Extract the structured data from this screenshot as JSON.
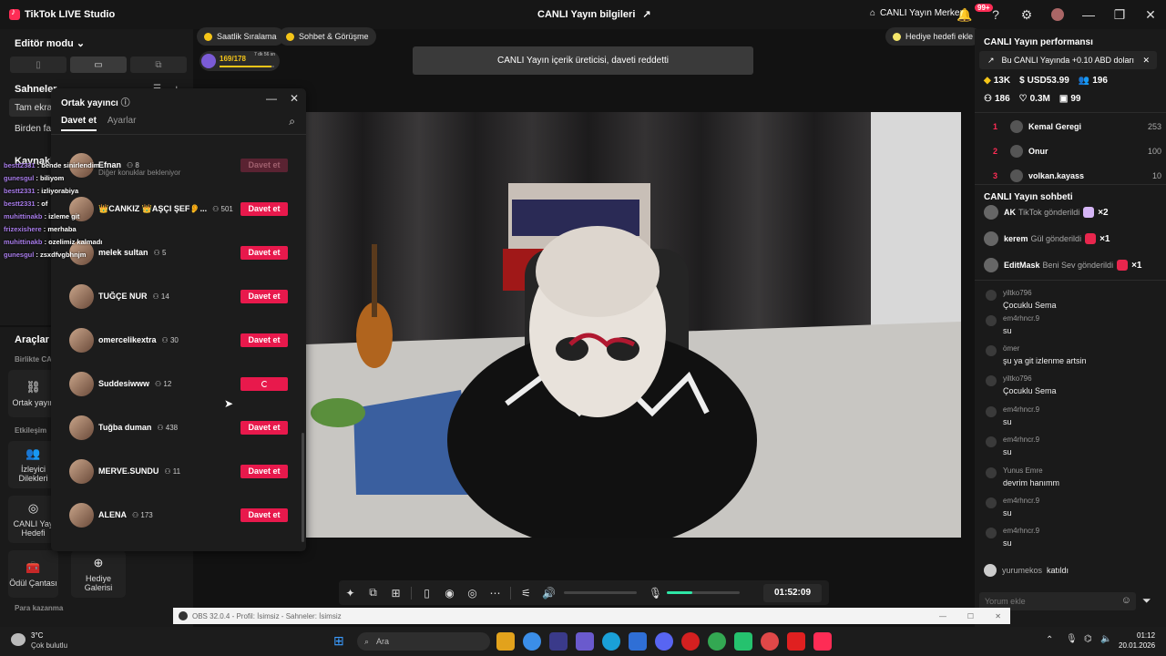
{
  "app": {
    "title": "TikTok LIVE Studio",
    "center_title": "CANLI Yayın bilgileri",
    "live_center": "CANLI Yayın Merkezi",
    "notif_badge": "99+"
  },
  "left": {
    "editor_mode": "Editör modu",
    "scenes": "Sahneler",
    "scene_items": [
      "Tam ekran",
      "Birden faz"
    ],
    "sources": "Kaynaklar",
    "tools": "Araçlar",
    "birlikte": "Birlikte CA",
    "cohost_tool": "Ortak yayın",
    "etkilesim": "Etkileşim",
    "viewer_req": [
      "İzleyici",
      "Dilekleri"
    ],
    "live_goal": [
      "CANLI Yay",
      "Hedefi"
    ],
    "reward_bag": "Ödül Çantası",
    "gift_gallery": [
      "Hediye",
      "Galerisi"
    ],
    "earn": "Para kazanma"
  },
  "top": {
    "hourly_rank": "Saatlik Sıralama",
    "chat_meet": "Sohbet & Görüşme",
    "progress": "169/178",
    "progress_time": "7 dk 56 sn",
    "progress_fraction": 0.95,
    "gift_goal": "Hediye hedefi ekle"
  },
  "toast": "CANLI Yayın içerik üreticisi, daveti reddetti",
  "cohost": {
    "title": "Ortak yayıncı",
    "tabs": [
      "Davet et",
      "Ayarlar"
    ],
    "waiting_text": "Diğer konuklar bekleniyor",
    "invite_label": "Davet et",
    "rows": [
      {
        "name": "Efnan",
        "count": "8",
        "state": "disabled"
      },
      {
        "name": "👑CANKIZ 👑AŞÇI ŞEF👂...",
        "count": "501",
        "state": "normal"
      },
      {
        "name": "melek sultan",
        "count": "5",
        "state": "normal"
      },
      {
        "name": "TUĞÇE NUR",
        "count": "14",
        "state": "normal"
      },
      {
        "name": "omercelikextra",
        "count": "30",
        "state": "normal"
      },
      {
        "name": "Suddesiwww",
        "count": "12",
        "state": "loading"
      },
      {
        "name": "Tuğba duman",
        "count": "438",
        "state": "normal"
      },
      {
        "name": "MERVE.SUNDU",
        "count": "11",
        "state": "normal"
      },
      {
        "name": "ALENA",
        "count": "173",
        "state": "normal"
      }
    ]
  },
  "overlay_chat": [
    {
      "user": "bestt2331",
      "text": "bende sinirlendim"
    },
    {
      "user": "gunesgul",
      "text": "biliyom"
    },
    {
      "user": "bestt2331",
      "text": "izliyorabiya"
    },
    {
      "user": "bestt2331",
      "text": "of"
    },
    {
      "user": "muhittinakb",
      "text": "izleme git"
    },
    {
      "user": "frizexishere",
      "text": "merhaba"
    },
    {
      "user": "muhittinakb",
      "text": "ozelimiz kalmadı"
    },
    {
      "user": "gunesgul",
      "text": "zsxdfvgbhnjm"
    }
  ],
  "right": {
    "perf_title": "CANLI Yayın performansı",
    "perf_note": "Bu CANLI Yayında +0.10 ABD doları",
    "stats": {
      "diamonds": "13K",
      "usd": "USD53.99",
      "viewers": "196",
      "followers": "186",
      "likes": "0.3M",
      "hundred": "99"
    },
    "ranking": [
      {
        "rank": "1",
        "name": "Kemal Geregi",
        "value": "253"
      },
      {
        "rank": "2",
        "name": "Onur",
        "value": "100"
      },
      {
        "rank": "3",
        "name": "volkan.kayass",
        "value": "10"
      }
    ],
    "chat_title": "CANLI Yayın sohbeti",
    "gifts": [
      {
        "user": "AK",
        "text": "TikTok gönderildi",
        "count": "×2"
      },
      {
        "user": "kerem",
        "text": "Gül gönderildi",
        "count": "×1"
      },
      {
        "user": "EditMask",
        "text": "Beni Sev gönderildi",
        "count": "×1"
      }
    ],
    "messages": [
      {
        "user": "yiltko796",
        "text": "Çocuklu Sema"
      },
      {
        "user": "em4rhncr.9",
        "text": "su"
      },
      {
        "user": "ömer",
        "text": "şu ya git izlenme artsin"
      },
      {
        "user": "yiltko796",
        "text": "Çocuklu Sema"
      },
      {
        "user": "em4rhncr.9",
        "text": "su"
      },
      {
        "user": "em4rhncr.9",
        "text": "su"
      },
      {
        "user": "Yunus Emre",
        "text": "devrim hanımm"
      },
      {
        "user": "em4rhncr.9",
        "text": "su"
      },
      {
        "user": "em4rhncr.9",
        "text": "su"
      }
    ],
    "joined_user": "yurumekos",
    "joined_text": "katıldı",
    "comment_placeholder": "Yorum ekle"
  },
  "controls": {
    "timer": "01:52:09",
    "mic_level": 0.35
  },
  "obs": {
    "title": "OBS 32.0.4 - Profil: İsimsiz - Sahneler: İsimsiz"
  },
  "taskbar": {
    "weather_temp": "3°C",
    "weather_desc": "Çok bulutlu",
    "search_placeholder": "Ara",
    "time": "01:12",
    "date": "20.01.2026"
  }
}
